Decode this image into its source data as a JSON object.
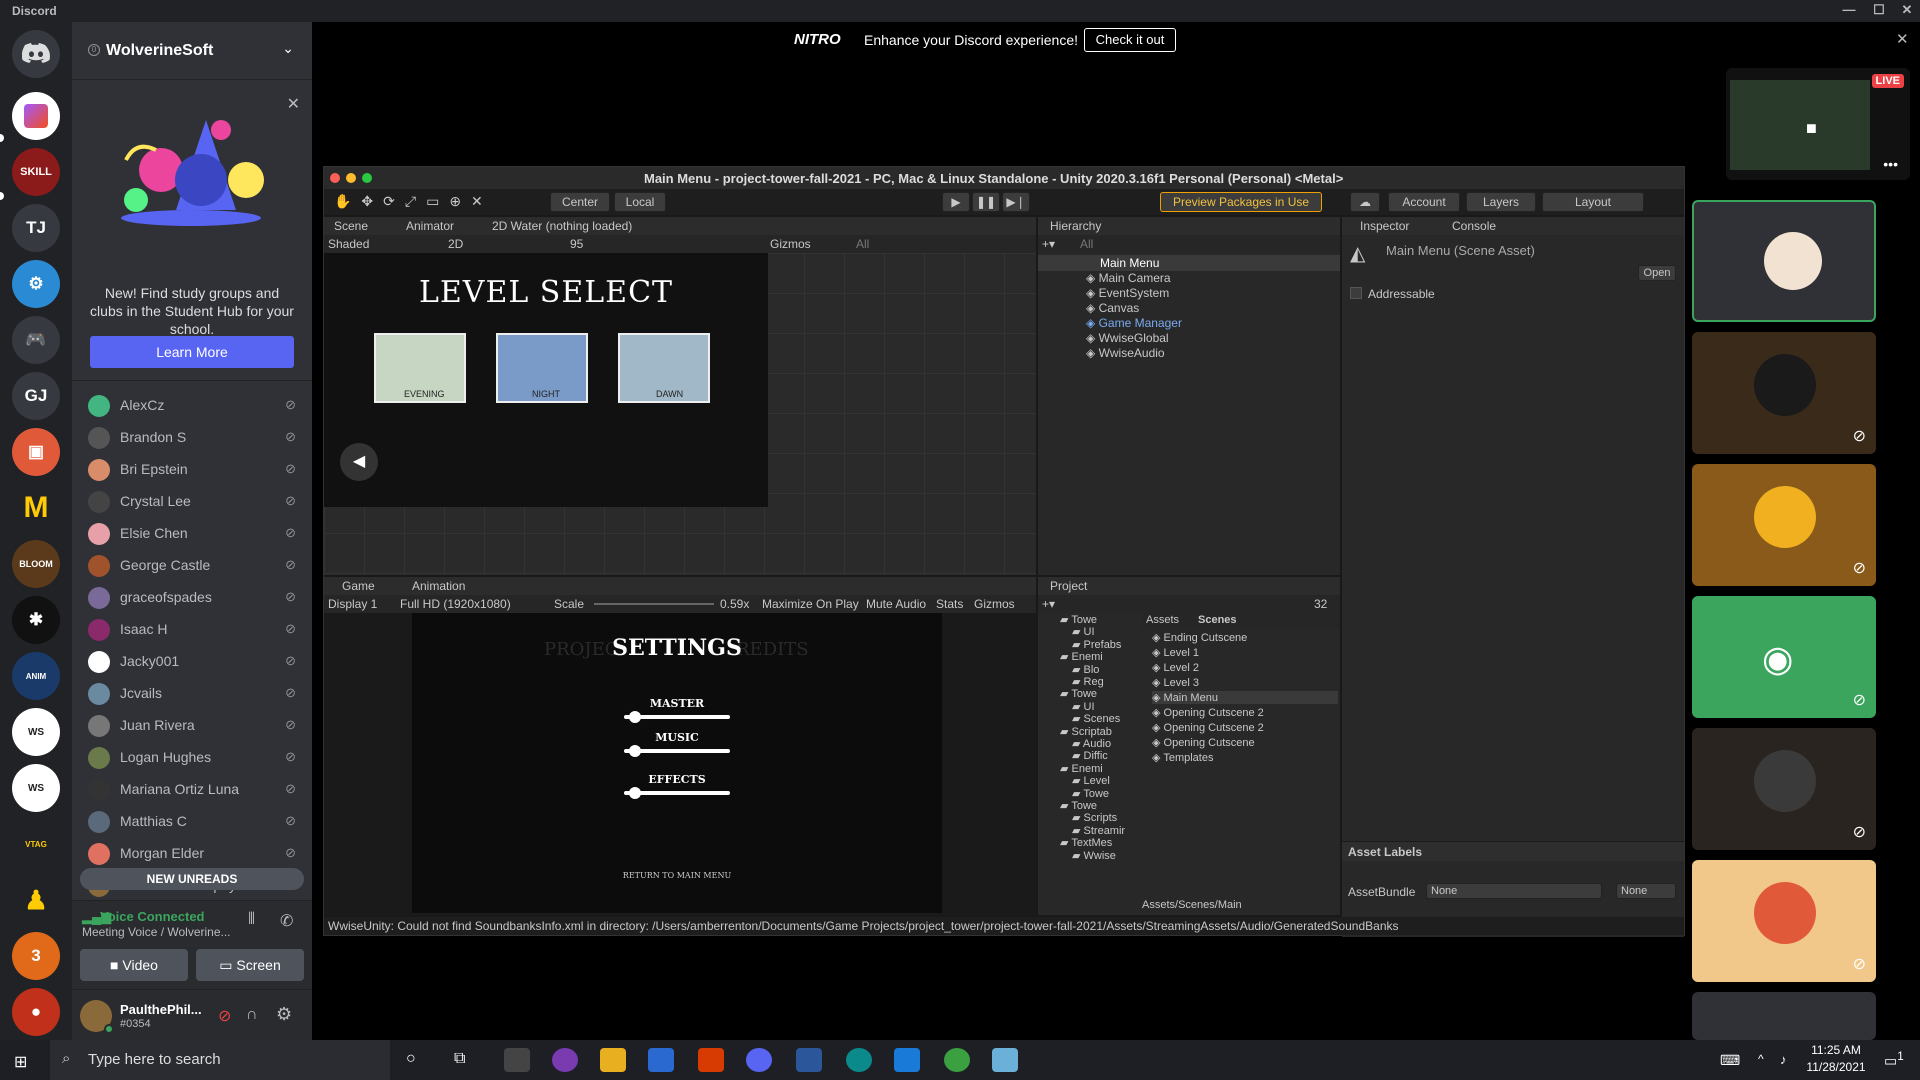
{
  "app": {
    "title": "Discord"
  },
  "nitro": {
    "logo": "NITRO",
    "message": "Enhance your Discord experience!",
    "button": "Check it out"
  },
  "server": {
    "name": "WolverineSoft",
    "badge": "0"
  },
  "promo": {
    "text": "New! Find study groups and clubs in the Student Hub for your school.",
    "button": "Learn More"
  },
  "members": [
    {
      "name": "AlexCz",
      "color": "#43b581"
    },
    {
      "name": "Brandon S",
      "color": "#555"
    },
    {
      "name": "Bri Epstein",
      "color": "#d98c6a"
    },
    {
      "name": "Crystal Lee",
      "color": "#444"
    },
    {
      "name": "Elsie Chen",
      "color": "#e8a0a8"
    },
    {
      "name": "George Castle",
      "color": "#a0522d"
    },
    {
      "name": "graceofspades",
      "color": "#7a6a9a"
    },
    {
      "name": "Isaac H",
      "color": "#8b2a6a"
    },
    {
      "name": "Jacky001",
      "color": "#ffffff"
    },
    {
      "name": "Jcvails",
      "color": "#6a8aa0"
    },
    {
      "name": "Juan Rivera",
      "color": "#777"
    },
    {
      "name": "Logan Hughes",
      "color": "#6a7a4a"
    },
    {
      "name": "Mariana Ortiz Luna",
      "color": "#333"
    },
    {
      "name": "Matthias C",
      "color": "#5a6a7a"
    },
    {
      "name": "Morgan Elder",
      "color": "#e07060"
    },
    {
      "name": "PaulthePhilosophy...",
      "color": "#8a6a3a"
    }
  ],
  "new_unreads": "NEW UNREADS",
  "voice": {
    "status": "Voice Connected",
    "channel": "Meeting Voice / Wolverine...",
    "video": "Video",
    "screen": "Screen"
  },
  "user": {
    "name": "PaulthePhil...",
    "tag": "#0354"
  },
  "guilds": [
    "TJ",
    "GJ"
  ],
  "unity": {
    "title": "Main Menu - project-tower-fall-2021 - PC, Mac & Linux Standalone - Unity 2020.3.16f1 Personal (Personal) <Metal>",
    "toolbar": {
      "center": "Center",
      "local": "Local",
      "preview": "Preview Packages in Use",
      "account": "Account",
      "layers": "Layers",
      "layout": "Layout"
    },
    "scene_tabs": [
      "Scene",
      "Animator",
      "2D Water (nothing loaded)"
    ],
    "scene_bar": {
      "shaded": "Shaded",
      "mode2d": "2D",
      "gizmos": "Gizmos",
      "search": "All",
      "hidden": "95"
    },
    "level_select": {
      "title": "LEVEL SELECT",
      "levels": [
        "EVENING",
        "NIGHT",
        "DAWN"
      ]
    },
    "hierarchy": {
      "tab": "Hierarchy",
      "search": "All",
      "root": "Main Menu",
      "items": [
        "Main Camera",
        "EventSystem",
        "Canvas",
        "Game Manager",
        "WwiseGlobal",
        "WwiseAudio"
      ]
    },
    "inspector": {
      "tabs": [
        "Inspector",
        "Console"
      ],
      "asset": "Main Menu (Scene Asset)",
      "open": "Open",
      "addressable": "Addressable",
      "labels": "Asset Labels",
      "bundle_label": "AssetBundle",
      "bundle": "None",
      "variant": "None"
    },
    "game": {
      "tabs": [
        "Game",
        "Animation"
      ],
      "display": "Display 1",
      "resolution": "Full HD (1920x1080)",
      "scale_label": "Scale",
      "scale": "0.59x",
      "maximize": "Maximize On Play",
      "mute": "Mute Audio",
      "stats": "Stats",
      "gizmos": "Gizmos"
    },
    "settings": {
      "title": "SETTINGS",
      "bg_left": "PROJEC",
      "bg_right": "REDITS",
      "master": "MASTER",
      "music": "MUSIC",
      "effects": "EFFECTS",
      "return": "RETURN TO MAIN MENU",
      "master_level": 0.05,
      "music_level": 0.05,
      "effects_level": 0.05
    },
    "project": {
      "tab": "Project",
      "count": "32",
      "breadcrumb_root": "Assets",
      "breadcrumb_leaf": "Scenes",
      "tree": [
        "Towe",
        "UI",
        "Prefabs",
        "Enemi",
        "Blo",
        "Reg",
        "Towe",
        "UI",
        "Scenes",
        "Scriptab",
        "Audio",
        "Diffic",
        "Enemi",
        "Level",
        "Towe",
        "Towe",
        "Scripts",
        "Streamir",
        "TextMes",
        "Wwise"
      ],
      "files": [
        "Ending Cutscene",
        "Level 1",
        "Level 2",
        "Level 3",
        "Main Menu",
        "Opening Cutscene 2",
        "Opening Cutscene 2",
        "Opening Cutscene",
        "Templates"
      ],
      "path": "Assets/Scenes/Main"
    },
    "status": "WwiseUnity: Could not find SoundbanksInfo.xml in directory: /Users/amberrenton/Documents/Game Projects/project_tower/project-tower-fall-2021/Assets/StreamingAssets/Audio/GeneratedSoundBanks"
  },
  "live": "LIVE",
  "taskbar": {
    "search": "Type here to search",
    "time": "11:25 AM",
    "date": "11/28/2021",
    "notif": "1"
  },
  "colors": {
    "discord_blurple": "#5865f2",
    "green": "#3ba55d",
    "unity_bg": "#191919"
  }
}
